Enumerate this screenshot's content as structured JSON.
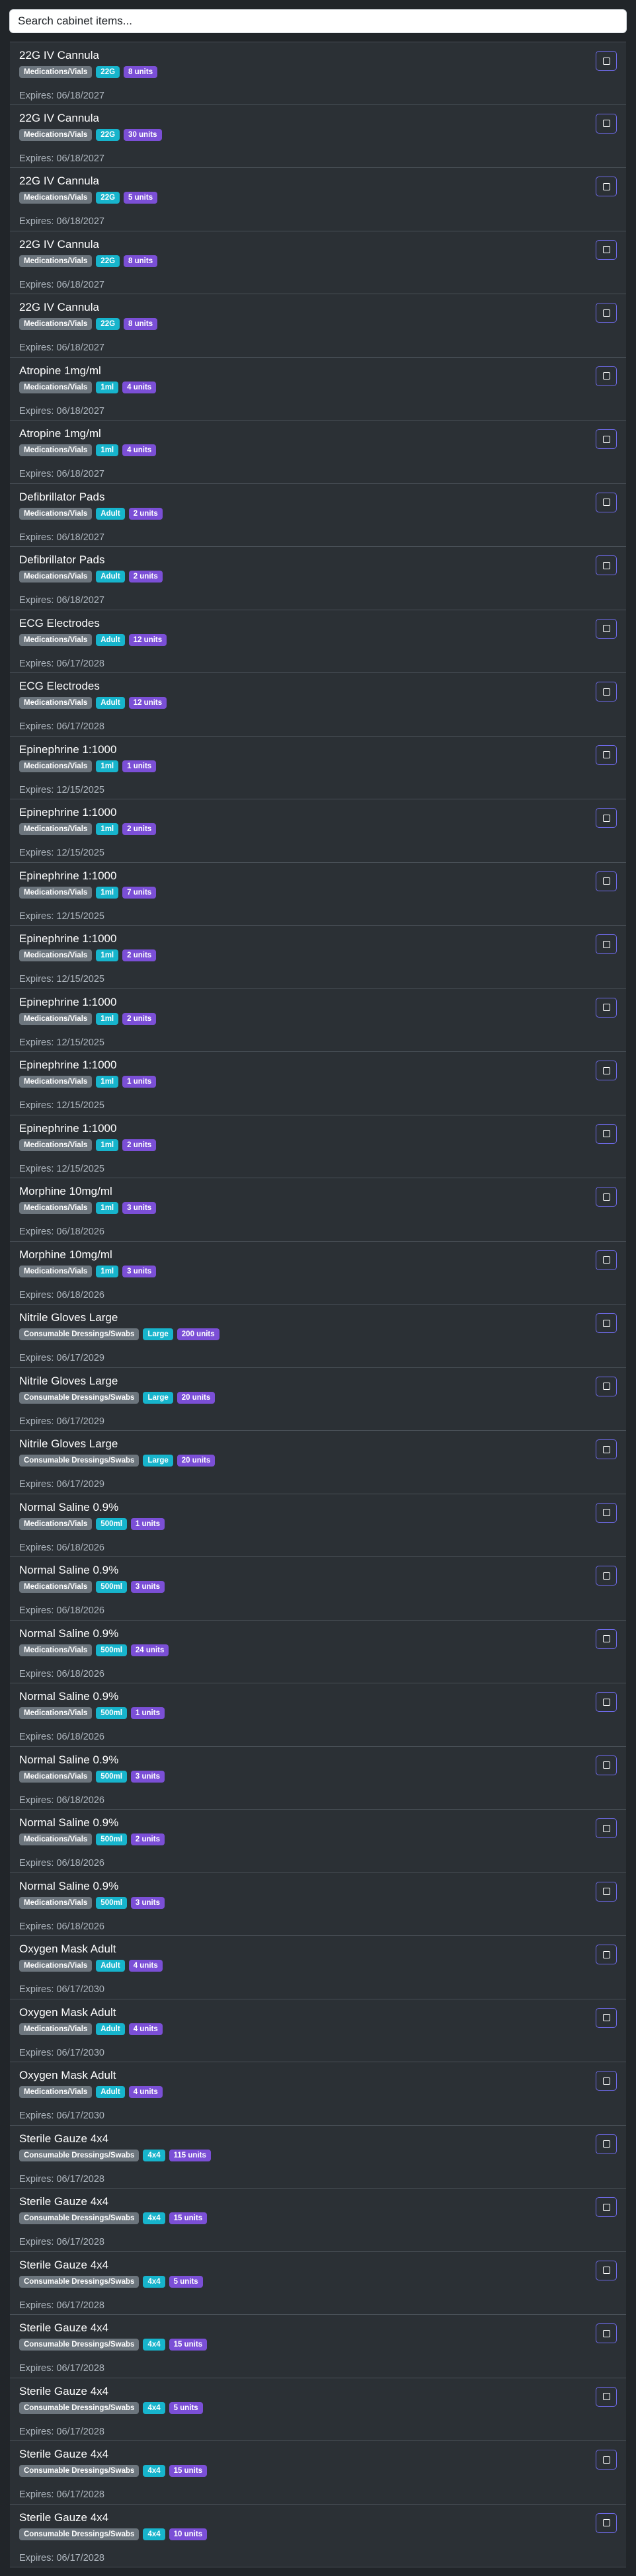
{
  "search": {
    "placeholder": "Search cabinet items..."
  },
  "expires_prefix": "Expires:",
  "colors": {
    "category": "#6c757d",
    "size": "#17b4cc",
    "quantity": "#7b4fd6",
    "select_border": "#6e6ae8"
  },
  "items": [
    {
      "name": "22G IV Cannula",
      "category": "Medications/Vials",
      "size": "22G",
      "quantity": "8 units",
      "expires": "06/18/2027"
    },
    {
      "name": "22G IV Cannula",
      "category": "Medications/Vials",
      "size": "22G",
      "quantity": "30 units",
      "expires": "06/18/2027"
    },
    {
      "name": "22G IV Cannula",
      "category": "Medications/Vials",
      "size": "22G",
      "quantity": "5 units",
      "expires": "06/18/2027"
    },
    {
      "name": "22G IV Cannula",
      "category": "Medications/Vials",
      "size": "22G",
      "quantity": "8 units",
      "expires": "06/18/2027"
    },
    {
      "name": "22G IV Cannula",
      "category": "Medications/Vials",
      "size": "22G",
      "quantity": "8 units",
      "expires": "06/18/2027"
    },
    {
      "name": "Atropine 1mg/ml",
      "category": "Medications/Vials",
      "size": "1ml",
      "quantity": "4 units",
      "expires": "06/18/2027"
    },
    {
      "name": "Atropine 1mg/ml",
      "category": "Medications/Vials",
      "size": "1ml",
      "quantity": "4 units",
      "expires": "06/18/2027"
    },
    {
      "name": "Defibrillator Pads",
      "category": "Medications/Vials",
      "size": "Adult",
      "quantity": "2 units",
      "expires": "06/18/2027"
    },
    {
      "name": "Defibrillator Pads",
      "category": "Medications/Vials",
      "size": "Adult",
      "quantity": "2 units",
      "expires": "06/18/2027"
    },
    {
      "name": "ECG Electrodes",
      "category": "Medications/Vials",
      "size": "Adult",
      "quantity": "12 units",
      "expires": "06/17/2028"
    },
    {
      "name": "ECG Electrodes",
      "category": "Medications/Vials",
      "size": "Adult",
      "quantity": "12 units",
      "expires": "06/17/2028"
    },
    {
      "name": "Epinephrine 1:1000",
      "category": "Medications/Vials",
      "size": "1ml",
      "quantity": "1 units",
      "expires": "12/15/2025"
    },
    {
      "name": "Epinephrine 1:1000",
      "category": "Medications/Vials",
      "size": "1ml",
      "quantity": "2 units",
      "expires": "12/15/2025"
    },
    {
      "name": "Epinephrine 1:1000",
      "category": "Medications/Vials",
      "size": "1ml",
      "quantity": "7 units",
      "expires": "12/15/2025"
    },
    {
      "name": "Epinephrine 1:1000",
      "category": "Medications/Vials",
      "size": "1ml",
      "quantity": "2 units",
      "expires": "12/15/2025"
    },
    {
      "name": "Epinephrine 1:1000",
      "category": "Medications/Vials",
      "size": "1ml",
      "quantity": "2 units",
      "expires": "12/15/2025"
    },
    {
      "name": "Epinephrine 1:1000",
      "category": "Medications/Vials",
      "size": "1ml",
      "quantity": "1 units",
      "expires": "12/15/2025"
    },
    {
      "name": "Epinephrine 1:1000",
      "category": "Medications/Vials",
      "size": "1ml",
      "quantity": "2 units",
      "expires": "12/15/2025"
    },
    {
      "name": "Morphine 10mg/ml",
      "category": "Medications/Vials",
      "size": "1ml",
      "quantity": "3 units",
      "expires": "06/18/2026"
    },
    {
      "name": "Morphine 10mg/ml",
      "category": "Medications/Vials",
      "size": "1ml",
      "quantity": "3 units",
      "expires": "06/18/2026"
    },
    {
      "name": "Nitrile Gloves Large",
      "category": "Consumable Dressings/Swabs",
      "size": "Large",
      "quantity": "200 units",
      "expires": "06/17/2029"
    },
    {
      "name": "Nitrile Gloves Large",
      "category": "Consumable Dressings/Swabs",
      "size": "Large",
      "quantity": "20 units",
      "expires": "06/17/2029"
    },
    {
      "name": "Nitrile Gloves Large",
      "category": "Consumable Dressings/Swabs",
      "size": "Large",
      "quantity": "20 units",
      "expires": "06/17/2029"
    },
    {
      "name": "Normal Saline 0.9%",
      "category": "Medications/Vials",
      "size": "500ml",
      "quantity": "1 units",
      "expires": "06/18/2026"
    },
    {
      "name": "Normal Saline 0.9%",
      "category": "Medications/Vials",
      "size": "500ml",
      "quantity": "3 units",
      "expires": "06/18/2026"
    },
    {
      "name": "Normal Saline 0.9%",
      "category": "Medications/Vials",
      "size": "500ml",
      "quantity": "24 units",
      "expires": "06/18/2026"
    },
    {
      "name": "Normal Saline 0.9%",
      "category": "Medications/Vials",
      "size": "500ml",
      "quantity": "1 units",
      "expires": "06/18/2026"
    },
    {
      "name": "Normal Saline 0.9%",
      "category": "Medications/Vials",
      "size": "500ml",
      "quantity": "3 units",
      "expires": "06/18/2026"
    },
    {
      "name": "Normal Saline 0.9%",
      "category": "Medications/Vials",
      "size": "500ml",
      "quantity": "2 units",
      "expires": "06/18/2026"
    },
    {
      "name": "Normal Saline 0.9%",
      "category": "Medications/Vials",
      "size": "500ml",
      "quantity": "3 units",
      "expires": "06/18/2026"
    },
    {
      "name": "Oxygen Mask Adult",
      "category": "Medications/Vials",
      "size": "Adult",
      "quantity": "4 units",
      "expires": "06/17/2030"
    },
    {
      "name": "Oxygen Mask Adult",
      "category": "Medications/Vials",
      "size": "Adult",
      "quantity": "4 units",
      "expires": "06/17/2030"
    },
    {
      "name": "Oxygen Mask Adult",
      "category": "Medications/Vials",
      "size": "Adult",
      "quantity": "4 units",
      "expires": "06/17/2030"
    },
    {
      "name": "Sterile Gauze 4x4",
      "category": "Consumable Dressings/Swabs",
      "size": "4x4",
      "quantity": "115 units",
      "expires": "06/17/2028"
    },
    {
      "name": "Sterile Gauze 4x4",
      "category": "Consumable Dressings/Swabs",
      "size": "4x4",
      "quantity": "15 units",
      "expires": "06/17/2028"
    },
    {
      "name": "Sterile Gauze 4x4",
      "category": "Consumable Dressings/Swabs",
      "size": "4x4",
      "quantity": "5 units",
      "expires": "06/17/2028"
    },
    {
      "name": "Sterile Gauze 4x4",
      "category": "Consumable Dressings/Swabs",
      "size": "4x4",
      "quantity": "15 units",
      "expires": "06/17/2028"
    },
    {
      "name": "Sterile Gauze 4x4",
      "category": "Consumable Dressings/Swabs",
      "size": "4x4",
      "quantity": "5 units",
      "expires": "06/17/2028"
    },
    {
      "name": "Sterile Gauze 4x4",
      "category": "Consumable Dressings/Swabs",
      "size": "4x4",
      "quantity": "15 units",
      "expires": "06/17/2028"
    },
    {
      "name": "Sterile Gauze 4x4",
      "category": "Consumable Dressings/Swabs",
      "size": "4x4",
      "quantity": "10 units",
      "expires": "06/17/2028"
    }
  ]
}
